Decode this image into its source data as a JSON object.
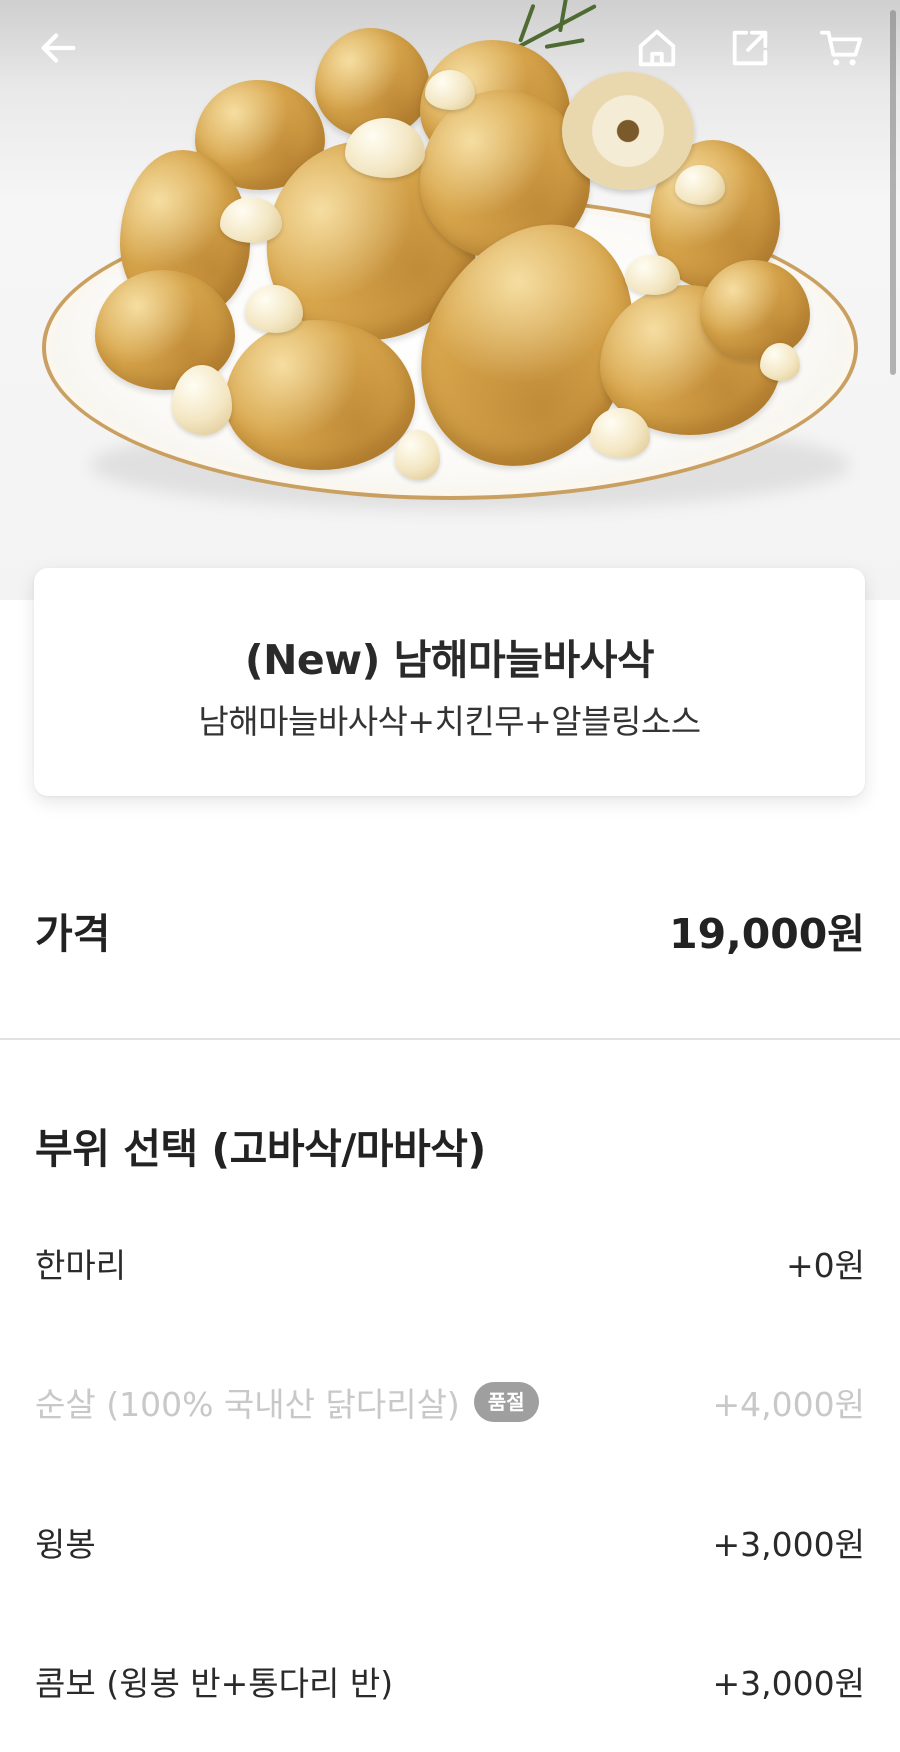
{
  "top_bar": {
    "icons": [
      "back-arrow-icon",
      "home-icon",
      "share-icon",
      "cart-icon"
    ]
  },
  "product": {
    "name": "(New) 남해마늘바사삭",
    "description": "남해마늘바사삭+치킨무+알블링소스"
  },
  "price": {
    "label": "가격",
    "value": "19,000원"
  },
  "part_selection": {
    "title": "부위 선택 (고바삭/마바삭)",
    "options": [
      {
        "name": "한마리",
        "price": "+0원",
        "sold_out": false
      },
      {
        "name": "순살 (100% 국내산 닭다리살)",
        "price": "+4,000원",
        "sold_out": true,
        "badge": "품절"
      },
      {
        "name": "윙봉",
        "price": "+3,000원",
        "sold_out": false
      },
      {
        "name": "콤보 (윙봉 반+통다리 반)",
        "price": "+3,000원",
        "sold_out": false
      }
    ]
  },
  "colors": {
    "text_primary": "#222222",
    "text_disabled": "#c8c8c8",
    "badge_bg": "#9f9f9f",
    "divider": "#e2e2e2"
  }
}
